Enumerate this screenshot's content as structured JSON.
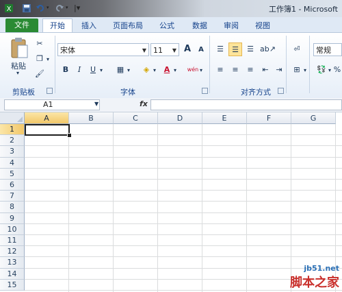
{
  "window": {
    "title": "工作簿1 - Microsoft"
  },
  "quick_access": {
    "icons": [
      "excel-icon",
      "save-icon",
      "undo-icon",
      "redo-icon",
      "customize-icon"
    ]
  },
  "tabs": [
    {
      "label": "文件"
    },
    {
      "label": "开始"
    },
    {
      "label": "插入"
    },
    {
      "label": "页面布局"
    },
    {
      "label": "公式"
    },
    {
      "label": "数据"
    },
    {
      "label": "审阅"
    },
    {
      "label": "视图"
    }
  ],
  "ribbon": {
    "clipboard": {
      "paste_label": "粘贴",
      "group_label": "剪贴板"
    },
    "font": {
      "font_name": "宋体",
      "font_size": "11",
      "bold": "B",
      "italic": "I",
      "underline": "U",
      "grow": "A",
      "shrink": "A",
      "font_color": "A",
      "phonetic": "wén",
      "group_label": "字体"
    },
    "alignment": {
      "group_label": "对齐方式"
    },
    "number": {
      "format": "常规"
    }
  },
  "formula_bar": {
    "name_box": "A1",
    "fx": "fx",
    "value": ""
  },
  "sheet": {
    "columns": [
      "A",
      "B",
      "C",
      "D",
      "E",
      "F",
      "G"
    ],
    "rows": [
      "1",
      "2",
      "3",
      "4",
      "5",
      "6",
      "7",
      "8",
      "9",
      "10",
      "11",
      "12",
      "13",
      "14",
      "15"
    ],
    "active_cell": "A1"
  },
  "watermark": {
    "line1": "jb51.net",
    "line2": "脚本之家"
  },
  "colors": {
    "accent_file_tab": "#2a8a34",
    "selection_highlight": "#f2c769",
    "ribbon_text": "#15428b"
  }
}
